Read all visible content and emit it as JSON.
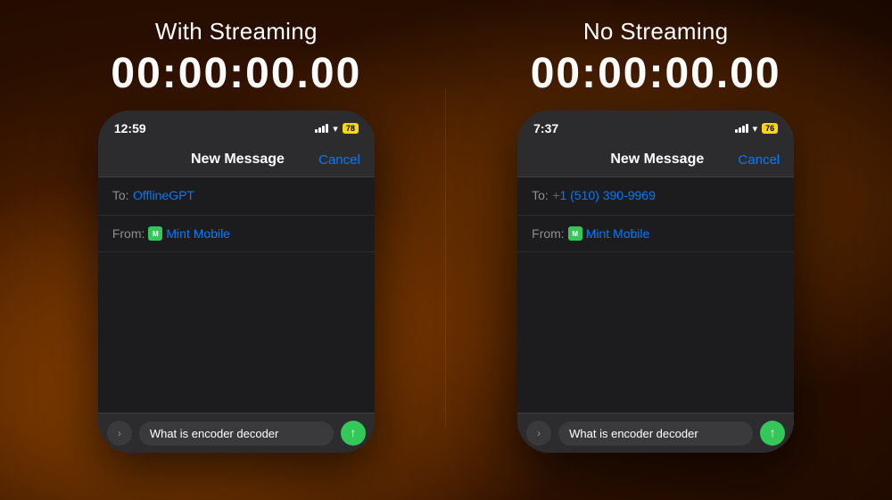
{
  "page": {
    "background": "#3a1a00"
  },
  "left_panel": {
    "title": "With Streaming",
    "timer": "00:00:00.00",
    "phone": {
      "status_bar": {
        "time": "12:59",
        "battery": "78"
      },
      "nav": {
        "title": "New Message",
        "cancel": "Cancel"
      },
      "to_label": "To:",
      "to_value": "OfflineGPT",
      "from_label": "From:",
      "from_icon": "M",
      "from_value": "Mint Mobile",
      "input_placeholder": "What is encoder decoder"
    }
  },
  "right_panel": {
    "title": "No Streaming",
    "timer": "00:00:00.00",
    "phone": {
      "status_bar": {
        "time": "7:37",
        "battery": "76"
      },
      "nav": {
        "title": "New Message",
        "cancel": "Cancel"
      },
      "to_label": "To:",
      "to_value": "+1 (510) 390-9969",
      "from_label": "From:",
      "from_icon": "M",
      "from_value": "Mint Mobile",
      "input_placeholder": "What is encoder decoder"
    }
  }
}
